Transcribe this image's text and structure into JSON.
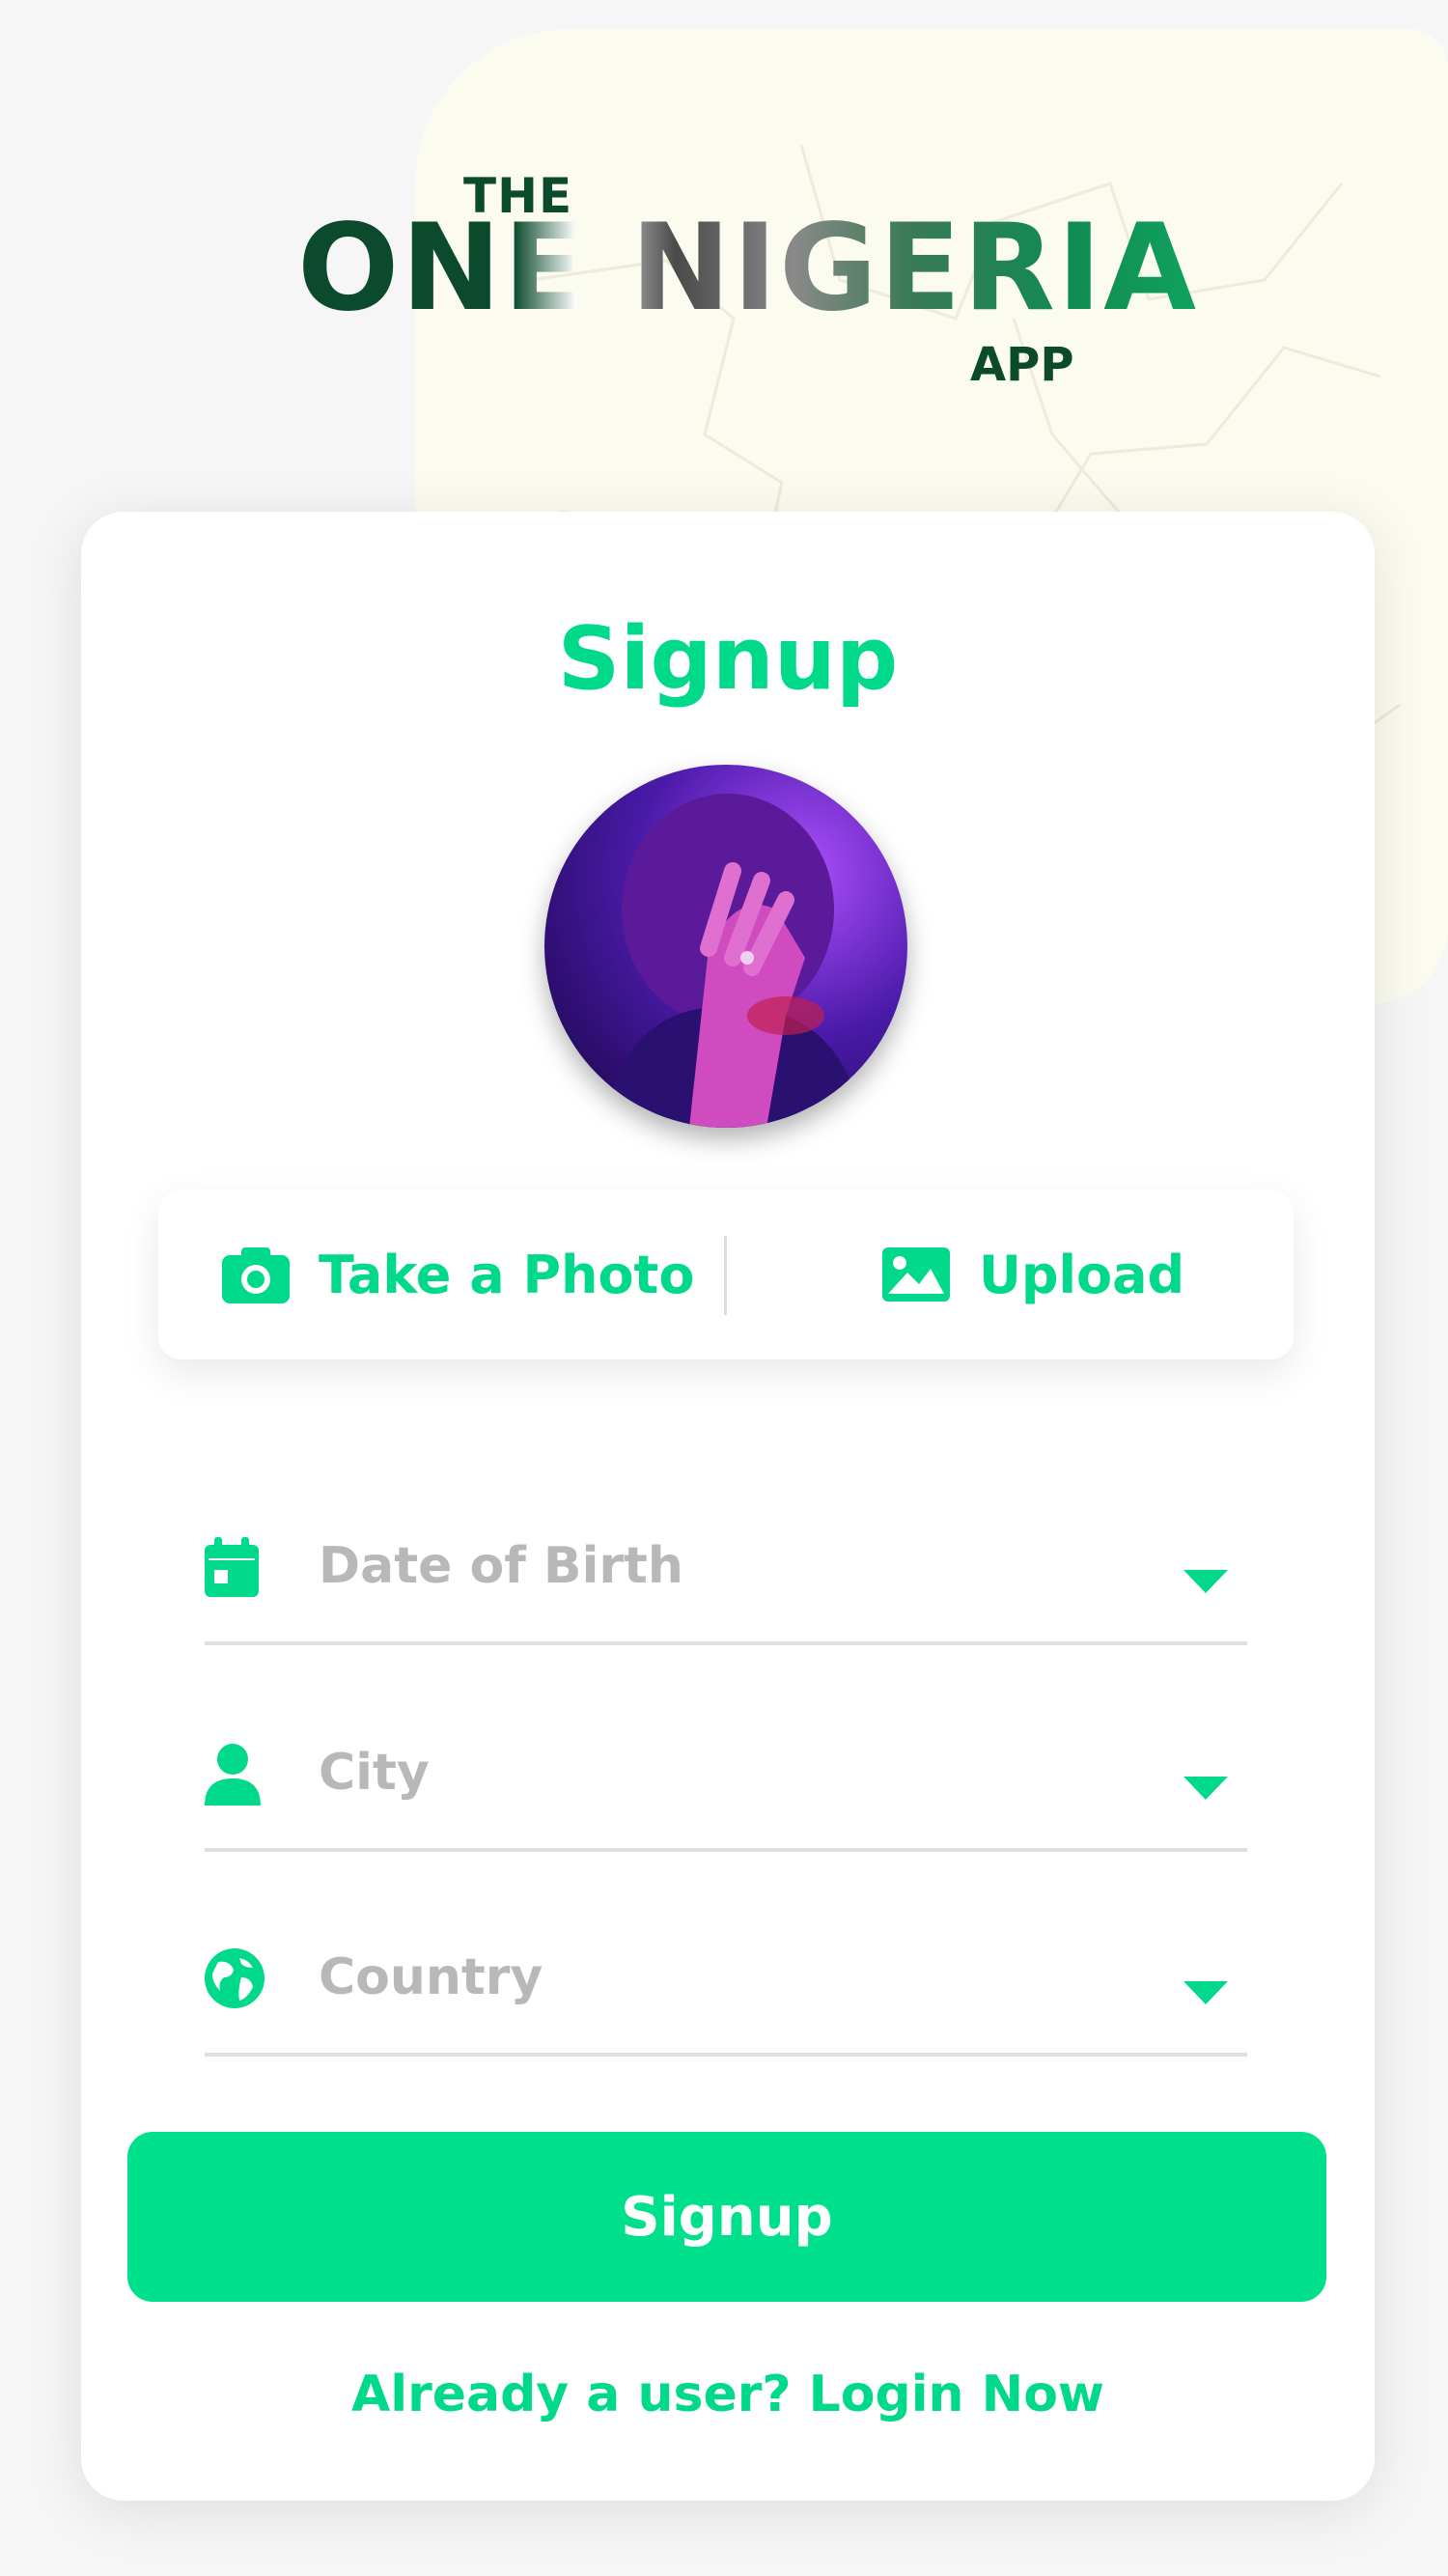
{
  "logo": {
    "the": "THE",
    "main": "ONE NIGERIA",
    "app": "APP"
  },
  "card": {
    "title": "Signup",
    "photo_actions": {
      "take_photo": "Take a Photo",
      "upload": "Upload"
    },
    "fields": {
      "dob": {
        "label": "Date of Birth",
        "icon": "calendar-icon"
      },
      "city": {
        "label": "City",
        "icon": "user-icon"
      },
      "country": {
        "label": "Country",
        "icon": "globe-icon"
      }
    },
    "submit_label": "Signup",
    "login_link": "Already a user? Login Now"
  },
  "colors": {
    "accent": "#00d98a",
    "button": "#00e08c",
    "logo_green": "#0b4a2c",
    "placeholder": "#b8b8b8"
  }
}
